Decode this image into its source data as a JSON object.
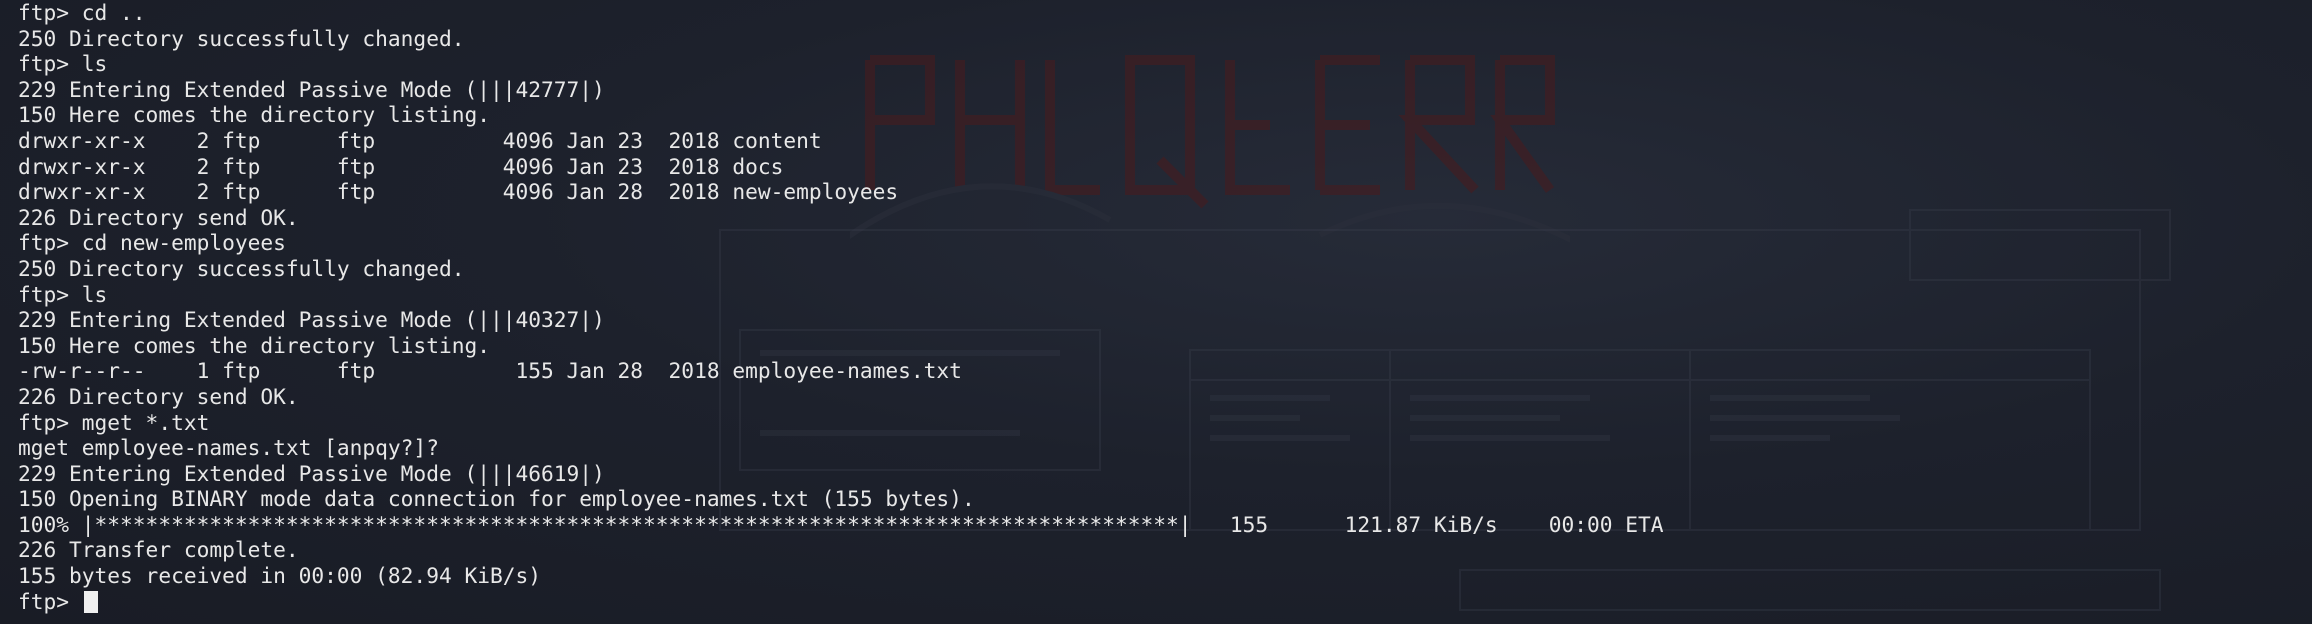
{
  "terminal": {
    "lines": [
      "ftp> cd ..",
      "250 Directory successfully changed.",
      "ftp> ls",
      "229 Entering Extended Passive Mode (|||42777|)",
      "150 Here comes the directory listing.",
      "drwxr-xr-x    2 ftp      ftp          4096 Jan 23  2018 content",
      "drwxr-xr-x    2 ftp      ftp          4096 Jan 23  2018 docs",
      "drwxr-xr-x    2 ftp      ftp          4096 Jan 28  2018 new-employees",
      "226 Directory send OK.",
      "ftp> cd new-employees",
      "250 Directory successfully changed.",
      "ftp> ls",
      "229 Entering Extended Passive Mode (|||40327|)",
      "150 Here comes the directory listing.",
      "-rw-r--r--    1 ftp      ftp           155 Jan 28  2018 employee-names.txt",
      "226 Directory send OK.",
      "ftp> mget *.txt",
      "mget employee-names.txt [anpqy?]?",
      "229 Entering Extended Passive Mode (|||46619|)",
      "150 Opening BINARY mode data connection for employee-names.txt (155 bytes).",
      "100% |*************************************************************************************|   155      121.87 KiB/s    00:00 ETA",
      "226 Transfer complete.",
      "155 bytes received in 00:00 (82.94 KiB/s)"
    ],
    "prompt": "ftp> "
  },
  "colors": {
    "background": "#1b1f2a",
    "text": "#e8e8e8",
    "cursor": "#f0f0f0",
    "wallpaper_accent": "#5a1e1e"
  }
}
